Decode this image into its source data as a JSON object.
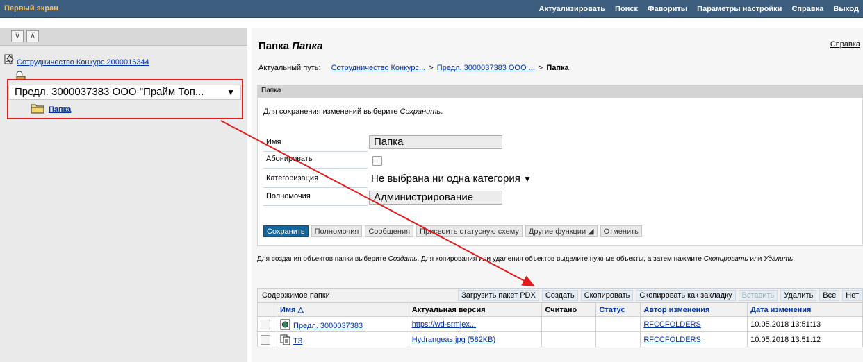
{
  "topbar": {
    "app_title": "Первый экран",
    "menu": [
      "Актуализировать",
      "Поиск",
      "Фавориты",
      "Параметры настройки",
      "Справка",
      "Выход"
    ]
  },
  "nav": {
    "root_link": "Сотрудничество Конкурс 2000016344",
    "node_label": "Предл. 3000037383 ООО \"Прайм Топ...",
    "node_caret": "▼",
    "child_link": "Папка",
    "toolbar_buttons": [
      "⊽",
      "⊼"
    ]
  },
  "main": {
    "title_prefix": "Папка",
    "title_italic": "Папка",
    "help": "Справка",
    "path_label": "Актуальный путь:",
    "path_items": [
      "Сотрудничество Конкурс...",
      "Предл. 3000037383 ООО ...",
      "Папка"
    ],
    "path_sep": ">"
  },
  "panel": {
    "header": "Папка",
    "hint_prefix": "Для сохранения изменений выберите ",
    "hint_italic": "Сохранить",
    "hint_suffix": ".",
    "fields": {
      "name_label": "Имя",
      "name_value": "Папка",
      "subscribe_label": "Абонировать",
      "category_label": "Категоризация",
      "category_value": "Не выбрана ни одна категория",
      "category_caret": "▼",
      "permissions_label": "Полномочия",
      "permissions_value": "Администрирование"
    },
    "buttons": [
      "Сохранить",
      "Полномочия",
      "Сообщения",
      "Присвоить статусную схему",
      "Другие функции ◢",
      "Отменить"
    ]
  },
  "create_hint": {
    "p1": "Для создания объектов папки выберите ",
    "i1": "Создать",
    "p2": ". Для копирования или удаления объектов выделите нужные объекты, а затем нажмите ",
    "i2": "Скопировать",
    "p3": " или ",
    "i3": "Удалить",
    "p4": "."
  },
  "table": {
    "title": "Содержимое папки",
    "toolbar_buttons": [
      {
        "label": "Загрузить пакет PDX",
        "enabled": true
      },
      {
        "label": "Создать",
        "enabled": true
      },
      {
        "label": "Скопировать",
        "enabled": true
      },
      {
        "label": "Скопировать как закладку",
        "enabled": true
      },
      {
        "label": "Вставить",
        "enabled": false
      },
      {
        "label": "Удалить",
        "enabled": true
      },
      {
        "label": "Все",
        "enabled": true
      },
      {
        "label": "Нет",
        "enabled": true
      }
    ],
    "columns": [
      "Имя △",
      "Актуальная версия",
      "Считано",
      "Статус",
      "Автор изменения",
      "Дата изменения"
    ],
    "rows": [
      {
        "name": "Предл. 3000037383",
        "version": "https://wd-srmjex...",
        "read": "",
        "status": "",
        "author": "RFCCFOLDERS",
        "date": "10.05.2018 13:51:13",
        "icon": "document-icon"
      },
      {
        "name": "ТЗ",
        "version": "Hydrangeas.jpg (582KB)",
        "read": "",
        "status": "",
        "author": "RFCCFOLDERS",
        "date": "10.05.2018 13:51:12",
        "icon": "file-copy-icon"
      }
    ]
  },
  "colors": {
    "topbar": "#3c5d7e",
    "accent_title": "#f0c060",
    "link": "#0033aa",
    "primary_button": "#14679d",
    "annotation": "#e21b1b"
  }
}
